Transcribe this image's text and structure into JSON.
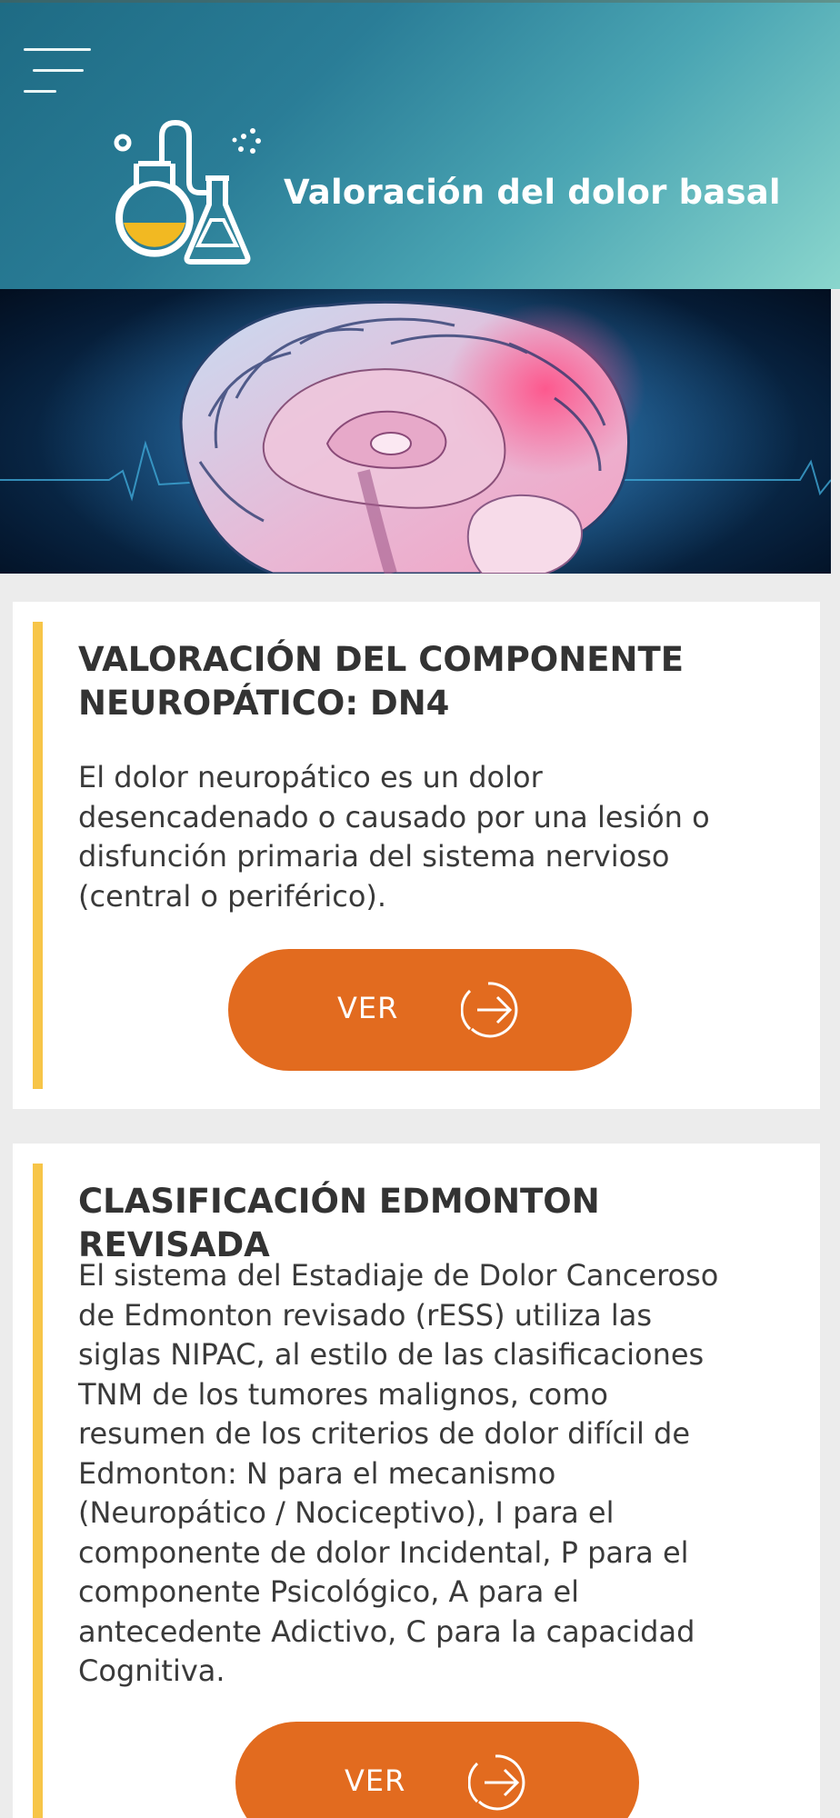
{
  "header": {
    "title": "Valoración del dolor basal",
    "menu_icon": "hamburger-menu-icon",
    "logo_icon": "lab-flasks-icon",
    "gradient_colors": [
      "#1e6b84",
      "#8ad6cd"
    ]
  },
  "banner": {
    "image": "brain-illustration"
  },
  "cards": [
    {
      "title_line1": "VALORACIÓN DEL COMPONENTE",
      "title_line2": "NEUROPÁTICO: DN4",
      "text_lines": [
        "El dolor neuropático es un dolor",
        "desencadenado o causado por una lesión o",
        "disfunción primaria del sistema nervioso",
        "(central o periférico)."
      ],
      "button_label": "VER"
    },
    {
      "title_line1": "CLASIFICACIÓN EDMONTON REVISADA",
      "text_lines": [
        "El sistema del Estadiaje de Dolor Canceroso",
        "de Edmonton revisado (rESS) utiliza las",
        "siglas NIPAC, al estilo de las clasificaciones",
        "TNM de los tumores malignos, como",
        "resumen de los criterios de dolor difícil de",
        "Edmonton: N para el mecanismo",
        "(Neuropático / Nociceptivo), I para el",
        "componente de dolor Incidental, P para el",
        "componente Psicológico, A para el",
        "antecedente Adictivo, C para la capacidad",
        "Cognitiva."
      ],
      "button_label": "VER"
    }
  ],
  "colors": {
    "accent_bar": "#f7c548",
    "button": "#e26b1f",
    "background": "#ececec"
  }
}
